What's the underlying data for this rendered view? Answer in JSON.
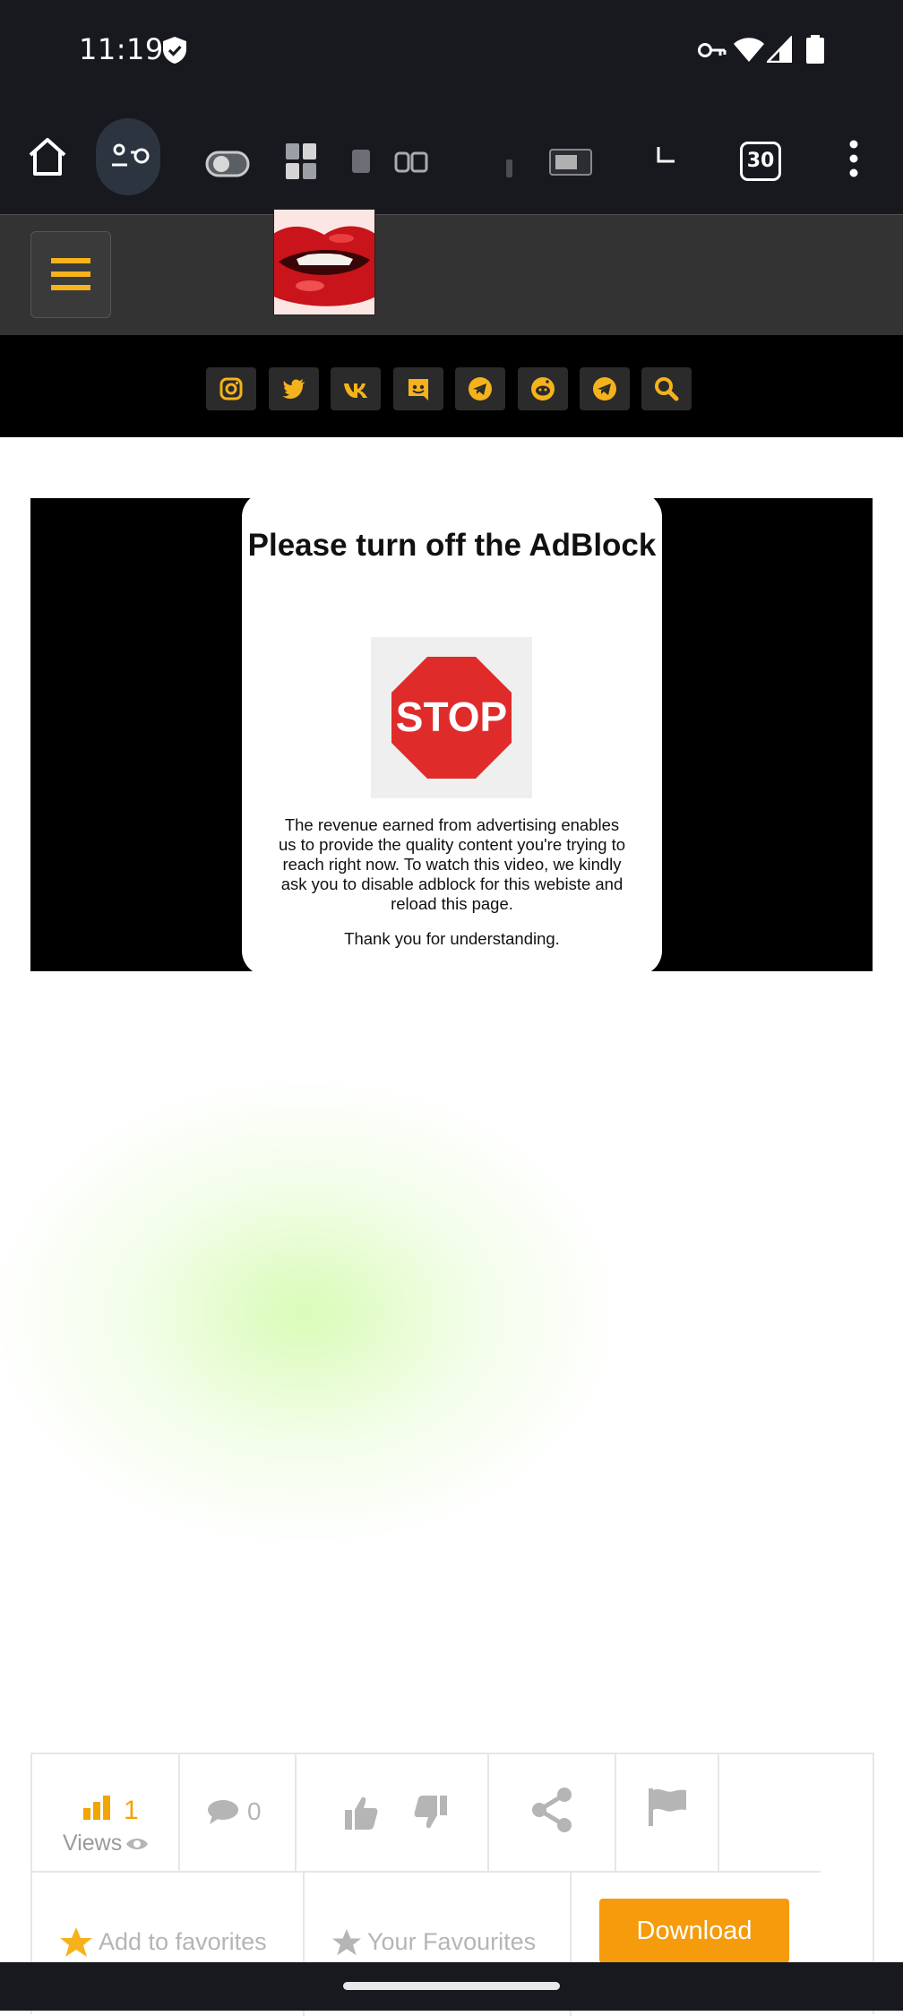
{
  "status_bar": {
    "time": "11:19",
    "icons": [
      "shield-check-icon",
      "vpn-key-icon",
      "wifi-icon",
      "cell-signal-icon",
      "battery-icon"
    ]
  },
  "browser_toolbar": {
    "icons": [
      "home-icon",
      "incognito-icon",
      "toggle-icon",
      "grid-icon",
      "tab-count-icon",
      "more-vert-icon"
    ],
    "tab_count": "30"
  },
  "site_header": {
    "menu_icon": "hamburger-icon",
    "logo": "lips-logo"
  },
  "social_links": [
    "instagram-icon",
    "twitter-icon",
    "vk-icon",
    "discord-icon",
    "telegram-icon",
    "reddit-icon",
    "telegram-icon",
    "search-icon"
  ],
  "colors": {
    "accent": "#f5b21b",
    "download": "#f59b0c",
    "stop_red": "#e02b2b",
    "views_orange": "#f0a500"
  },
  "adblock_modal": {
    "title": "Please turn off the AdBlock",
    "stop_text": "STOP",
    "message": "The revenue earned from advertising enables us to provide the quality content you're trying to reach right now. To watch this video, we kindly ask you to disable adblock for this webiste and reload this page.",
    "thanks": "Thank you for understanding."
  },
  "stats": {
    "views_count": "1",
    "views_label": "Views",
    "comments_count": "0",
    "add_to_favorites": "Add to favorites",
    "your_favourites": "Your Favourites",
    "download": "Download"
  }
}
